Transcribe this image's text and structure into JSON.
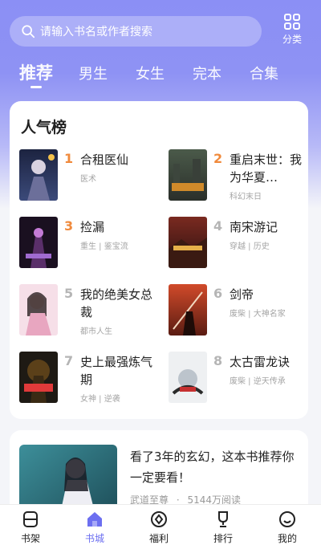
{
  "search": {
    "placeholder": "请输入书名或作者搜索"
  },
  "category_button": {
    "label": "分类"
  },
  "tabs": [
    {
      "label": "推荐",
      "active": true
    },
    {
      "label": "男生",
      "active": false
    },
    {
      "label": "女生",
      "active": false
    },
    {
      "label": "完本",
      "active": false
    },
    {
      "label": "合集",
      "active": false
    }
  ],
  "ranking": {
    "title": "人气榜",
    "items": [
      {
        "rank": "1",
        "title": "合租医仙",
        "tags": "医术"
      },
      {
        "rank": "2",
        "title": "重启末世：我为华夏…",
        "tags": "科幻末日"
      },
      {
        "rank": "3",
        "title": "捡漏",
        "tags": "重生 | 鉴宝流"
      },
      {
        "rank": "4",
        "title": "南宋游记",
        "tags": "穿越 | 历史"
      },
      {
        "rank": "5",
        "title": "我的绝美女总裁",
        "tags": "都市人生"
      },
      {
        "rank": "6",
        "title": "剑帝",
        "tags": "废柴 | 大神名家"
      },
      {
        "rank": "7",
        "title": "史上最强炼气期",
        "tags": "女神 | 逆袭"
      },
      {
        "rank": "8",
        "title": "太古雷龙诀",
        "tags": "废柴 | 逆天传承"
      }
    ],
    "rank_colors": {
      "top": "#f08a3c",
      "normal": "#b5b5b5"
    }
  },
  "feature": {
    "headline": "看了3年的玄幻，这本书推荐你一定要看！",
    "author": "武道至尊",
    "separator": "·",
    "reads": "5144万阅读"
  },
  "bottom_nav": [
    {
      "label": "书架",
      "icon": "bookshelf-icon",
      "active": false
    },
    {
      "label": "书城",
      "icon": "bookstore-icon",
      "active": true
    },
    {
      "label": "福利",
      "icon": "gift-coin-icon",
      "active": false
    },
    {
      "label": "排行",
      "icon": "trophy-icon",
      "active": false
    },
    {
      "label": "我的",
      "icon": "smiley-icon",
      "active": false
    }
  ],
  "colors": {
    "accent": "#6c6ff0",
    "header_gradient_top": "#8b8ff5"
  }
}
